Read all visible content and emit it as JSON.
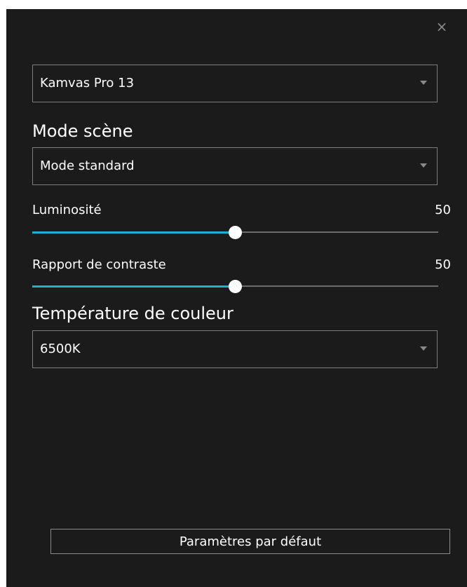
{
  "window": {
    "close_symbol": "×",
    "close_icon": "close-icon"
  },
  "device": {
    "selected": "Kamvas Pro 13",
    "caret_icon": "dropdown-caret-icon"
  },
  "scene_mode": {
    "heading": "Mode scène",
    "selected": "Mode standard"
  },
  "brightness": {
    "label": "Luminosité",
    "value": "50",
    "level": 50
  },
  "contrast": {
    "label": "Rapport de contraste",
    "value": "50",
    "level": 50
  },
  "color_temperature": {
    "heading": "Température de couleur",
    "selected": "6500K"
  },
  "footer": {
    "reset_label": "Paramètres par défaut"
  },
  "colors": {
    "background": "#1b1b1b",
    "accent": "#18b2d9",
    "border": "#7d7d7d",
    "text": "#ffffff",
    "muted": "#8a8a8a"
  }
}
